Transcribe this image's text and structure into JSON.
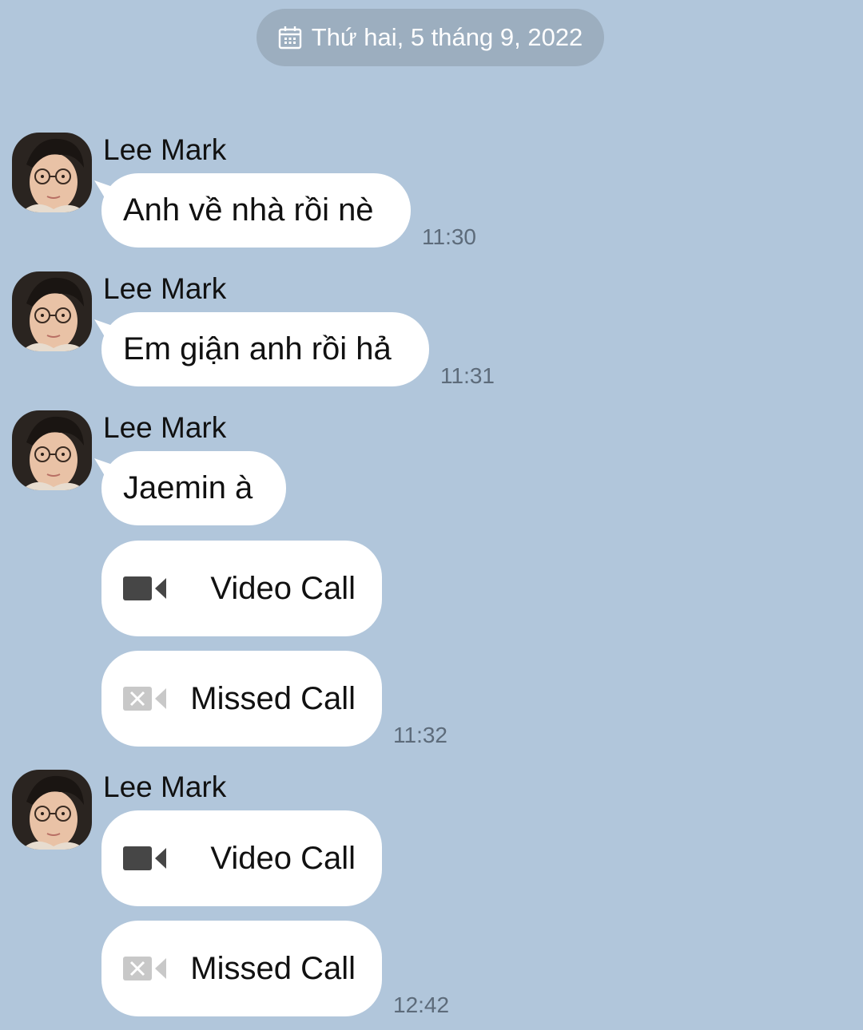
{
  "date_header": {
    "text": "Thứ hai, 5 tháng 9, 2022",
    "icon": "calendar-icon"
  },
  "messages": [
    {
      "sender": "Lee Mark",
      "text": "Anh về nhà rồi nè",
      "time": "11:30"
    },
    {
      "sender": "Lee Mark",
      "text": "Em giận anh rồi hả",
      "time": "11:31"
    },
    {
      "sender": "Lee Mark",
      "text": "Jaemin à"
    },
    {
      "call_video": "Video Call",
      "call_missed": "Missed Call",
      "time": "11:32"
    },
    {
      "sender": "Lee Mark",
      "call_video": "Video Call",
      "call_missed": "Missed Call",
      "time": "12:42"
    }
  ],
  "colors": {
    "background": "#b1c6db",
    "bubble": "#ffffff",
    "date_pill": "#9caebf",
    "time_text": "#5d6b7a"
  }
}
